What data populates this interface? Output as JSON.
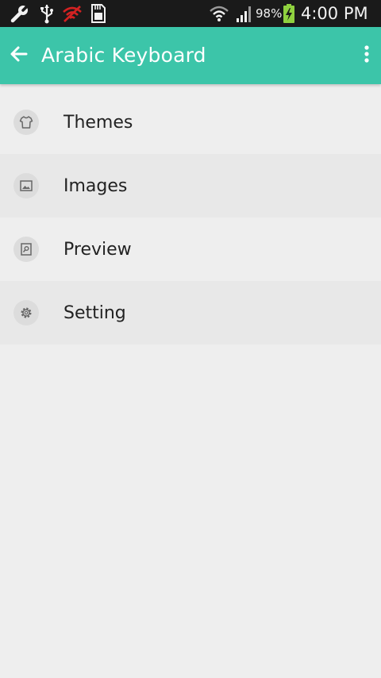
{
  "status_bar": {
    "battery_percent": "98%",
    "time": "4:00 PM",
    "icons": [
      "wrench-icon",
      "usb-icon",
      "wifi-off-icon",
      "sd-card-icon",
      "wifi-icon",
      "signal-icon",
      "battery-charging-icon"
    ]
  },
  "app_bar": {
    "title": "Arabic Keyboard",
    "back_icon": "arrow-left-icon",
    "menu_icon": "more-vertical-icon",
    "background_color": "#3cc5a9"
  },
  "menu": {
    "items": [
      {
        "label": "Themes",
        "icon": "tshirt-icon"
      },
      {
        "label": "Images",
        "icon": "image-icon"
      },
      {
        "label": "Preview",
        "icon": "preview-icon"
      },
      {
        "label": "Setting",
        "icon": "gear-icon"
      }
    ]
  }
}
